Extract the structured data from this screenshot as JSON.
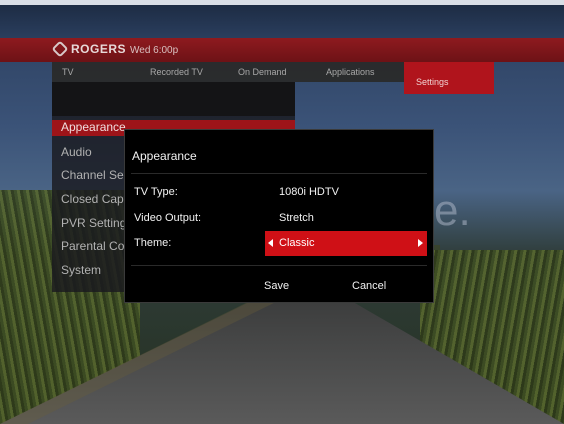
{
  "header": {
    "brand": "ROGERS",
    "datetime": "Wed 6:00p",
    "tabs": [
      "TV",
      "Recorded TV",
      "On Demand",
      "Applications",
      "Settings"
    ]
  },
  "sidebar": {
    "items": [
      "Appearance",
      "Audio",
      "Channel Setu",
      "Closed Captio",
      "PVR Settings",
      "Parental Cont",
      "System"
    ]
  },
  "dialog": {
    "title": "Appearance",
    "rows": [
      {
        "label": "TV Type:",
        "value": "1080i HDTV"
      },
      {
        "label": "Video Output:",
        "value": "Stretch"
      },
      {
        "label": "Theme:",
        "value": "Classic"
      }
    ],
    "save_label": "Save",
    "cancel_label": "Cancel"
  },
  "background": {
    "partial_text": "e."
  },
  "colors": {
    "accent_red": "#cf1016",
    "header_red": "#8e1a1f",
    "dialog_bg": "#000000"
  }
}
